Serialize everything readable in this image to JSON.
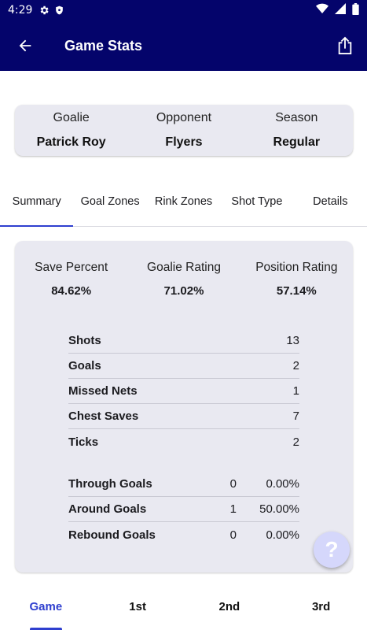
{
  "status_bar": {
    "time": "4:29"
  },
  "app_bar": {
    "title": "Game Stats"
  },
  "info": [
    {
      "label": "Goalie",
      "value": "Patrick Roy"
    },
    {
      "label": "Opponent",
      "value": "Flyers"
    },
    {
      "label": "Season",
      "value": "Regular"
    }
  ],
  "tabs": [
    "Summary",
    "Goal Zones",
    "Rink Zones",
    "Shot Type",
    "Details"
  ],
  "metrics": [
    {
      "label": "Save Percent",
      "value": "84.62%"
    },
    {
      "label": "Goalie Rating",
      "value": "71.02%"
    },
    {
      "label": "Position Rating",
      "value": "57.14%"
    }
  ],
  "stats": [
    {
      "name": "Shots",
      "value": "13"
    },
    {
      "name": "Goals",
      "value": "2"
    },
    {
      "name": "Missed Nets",
      "value": "1"
    },
    {
      "name": "Chest Saves",
      "value": "7"
    },
    {
      "name": "Ticks",
      "value": "2"
    }
  ],
  "goal_types": [
    {
      "name": "Through Goals",
      "count": "0",
      "percent": "0.00%"
    },
    {
      "name": "Around Goals",
      "count": "1",
      "percent": "50.00%"
    },
    {
      "name": "Rebound Goals",
      "count": "0",
      "percent": "0.00%"
    }
  ],
  "help_fab": "?",
  "period_tabs": [
    "Game",
    "1st",
    "2nd",
    "3rd"
  ],
  "colors": {
    "primary": "#04046b",
    "accent": "#2f3fcf",
    "card": "#e9e9f1"
  },
  "icons": {
    "status": [
      "gear-icon",
      "shield-icon",
      "wifi-icon",
      "signal-icon",
      "battery-icon"
    ],
    "app_bar": [
      "back-arrow-icon",
      "share-icon"
    ]
  }
}
